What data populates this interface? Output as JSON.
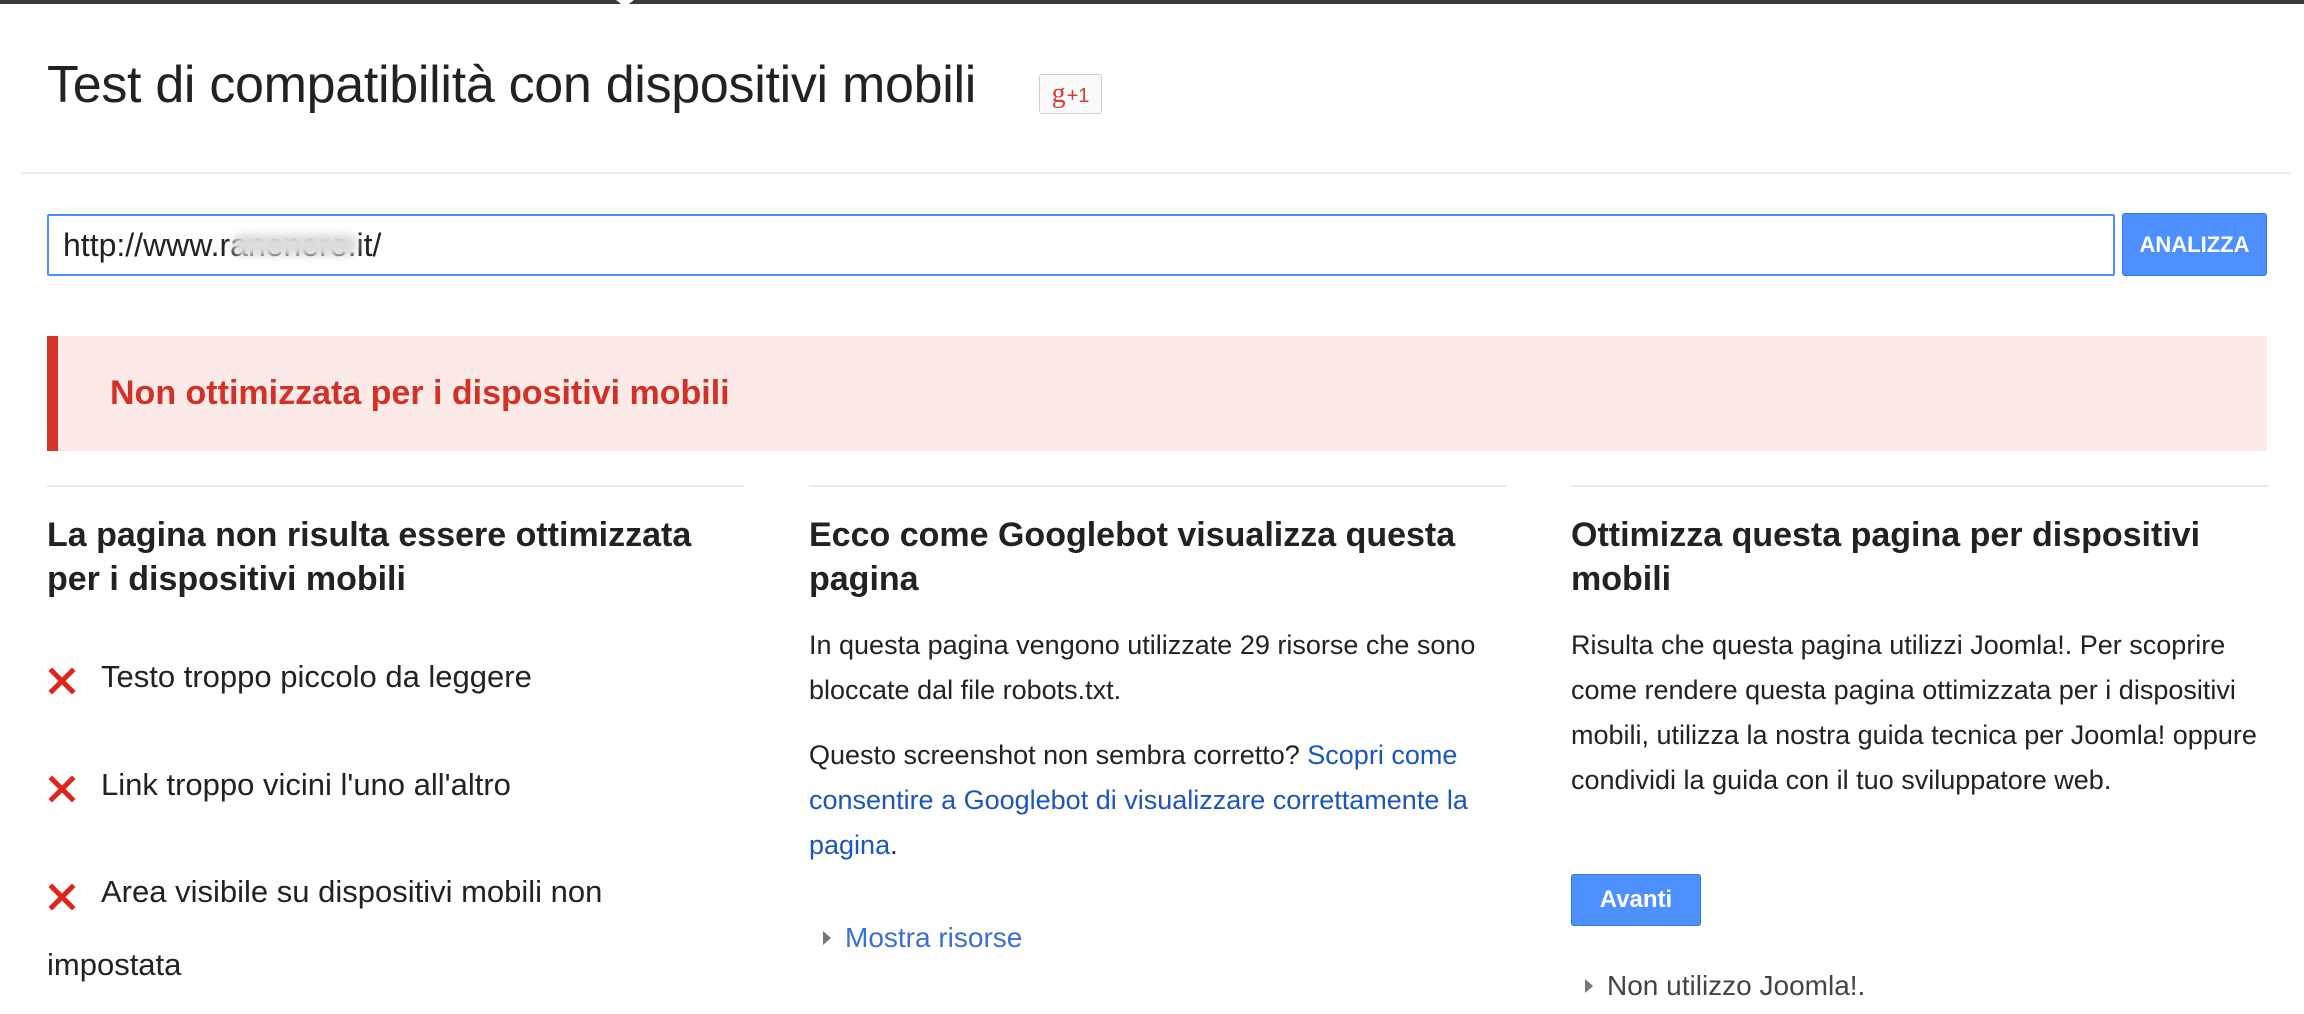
{
  "header": {
    "title": "Test di compatibilità con dispositivi mobili",
    "gplus_g": "g",
    "gplus_count": "+1"
  },
  "search": {
    "url_value": "http://www.ranenere.it/",
    "analyze_label": "ANALIZZA"
  },
  "result": {
    "status": "Non ottimizzata per i dispositivi mobili",
    "status_color": "#d23226"
  },
  "left_column": {
    "title": "La pagina non risulta essere ottimizzata per i dispositivi mobili",
    "issues": [
      {
        "icon": "red-x-icon",
        "text": "Testo troppo piccolo da leggere"
      },
      {
        "icon": "red-x-icon",
        "text": "Link troppo vicini l'uno all'altro"
      },
      {
        "icon": "red-x-icon",
        "text": "Area visibile su dispositivi mobili non impostata"
      }
    ]
  },
  "middle_column": {
    "title": "Ecco come Googlebot visualizza questa pagina",
    "blocked_text": "In questa pagina vengono utilizzate 29 risorse che sono bloccate dal file robots.txt.",
    "screenshot_question": "Questo screenshot non sembra corretto?",
    "learn_link": "Scopri come consentire a Googlebot di visualizzare correttamente la pagina",
    "show_resources": "Mostra risorse"
  },
  "right_column": {
    "title": "Ottimizza questa pagina per dispositivi mobili",
    "body": "Risulta che questa pagina utilizzi Joomla!. Per scoprire come rendere questa pagina ottimizzata per i dispositivi mobili, utilizza la nostra guida tecnica per Joomla! oppure condividi la guida con il tuo sviluppatore web.",
    "next_label": "Avanti",
    "not_joomla": "Non utilizzo Joomla!."
  },
  "colors": {
    "accent_blue": "#4d90fe",
    "link_blue": "#1a55c2",
    "error_red": "#d6342a",
    "alert_bg": "#fbeae8"
  }
}
